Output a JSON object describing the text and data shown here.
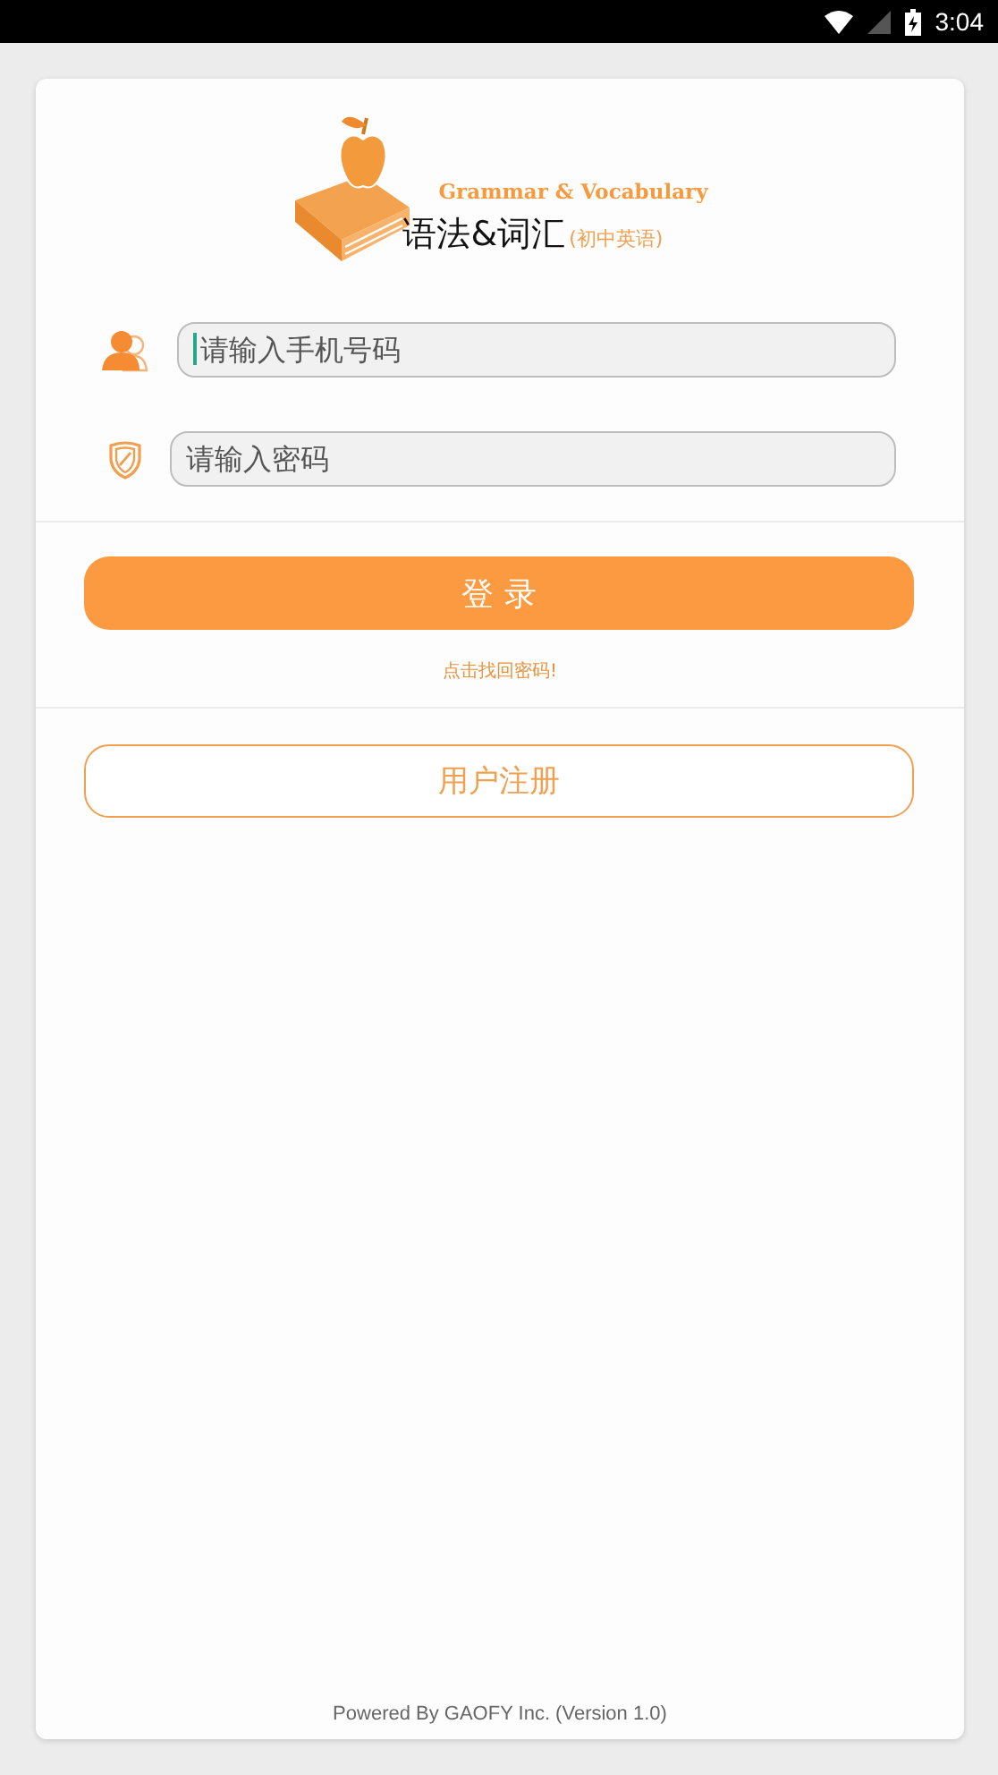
{
  "status_bar": {
    "time": "3:04"
  },
  "logo": {
    "subtitle_en": "Grammar & Vocabulary",
    "title": "语法&词汇",
    "tag": "(初中英语)"
  },
  "fields": [
    {
      "kind": "user",
      "placeholder": "请输入手机号码",
      "focused": true
    },
    {
      "kind": "lock",
      "placeholder": "请输入密码",
      "focused": false
    }
  ],
  "login_button": "登 录",
  "forgot_link": "点击找回密码!",
  "register_button": "用户注册",
  "footer": "Powered By GAOFY Inc. (Version 1.0)"
}
